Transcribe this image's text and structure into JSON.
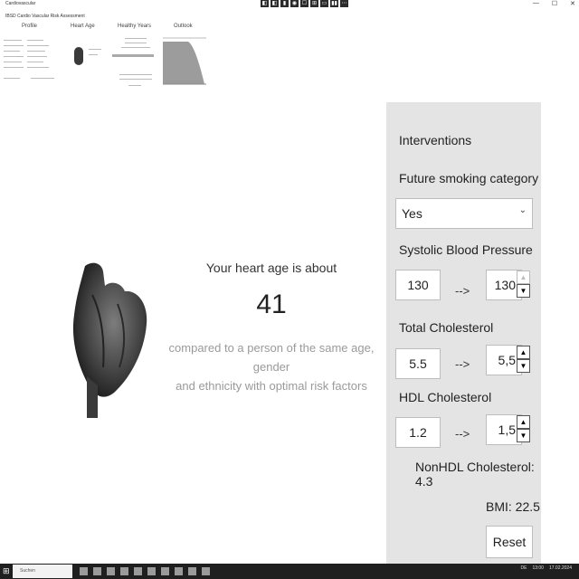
{
  "window": {
    "app_title": "Cardiovascular",
    "doc_title": "IBSD Cardio Vascular Risk Assessment",
    "controls": [
      "◧",
      "◧",
      "▮",
      "◉",
      "☐",
      "⊞",
      "▭",
      "▮▮",
      "⋯"
    ],
    "buttons": [
      "—",
      "☐",
      "✕"
    ]
  },
  "thumbnails": [
    {
      "label": "Profile"
    },
    {
      "label": "Heart Age"
    },
    {
      "label": "Healthy Years"
    },
    {
      "label": "Outlook"
    }
  ],
  "main": {
    "title": "Your heart age is about",
    "age": "41",
    "subtitle_line1": "compared to a person of the same age, gender",
    "subtitle_line2": "and ethnicity with optimal risk factors"
  },
  "panel": {
    "heading": "Interventions",
    "smoking": {
      "label": "Future smoking category",
      "value": "Yes"
    },
    "sbp": {
      "label": "Systolic Blood Pressure",
      "current": "130",
      "arrow": "-->",
      "future": "130"
    },
    "tc": {
      "label": "Total Cholesterol",
      "current": "5.5",
      "arrow": "-->",
      "future": "5,5"
    },
    "hdl": {
      "label": "HDL Cholesterol",
      "current": "1.2",
      "arrow": "-->",
      "future": "1,5"
    },
    "nonhdl": "NonHDL Cholesterol: 4.3",
    "bmi": "BMI: 22.5",
    "reset": "Reset"
  },
  "taskbar": {
    "search_placeholder": "Suchen",
    "time": "13:00",
    "lang": "DE",
    "date": "17.02.2024"
  }
}
